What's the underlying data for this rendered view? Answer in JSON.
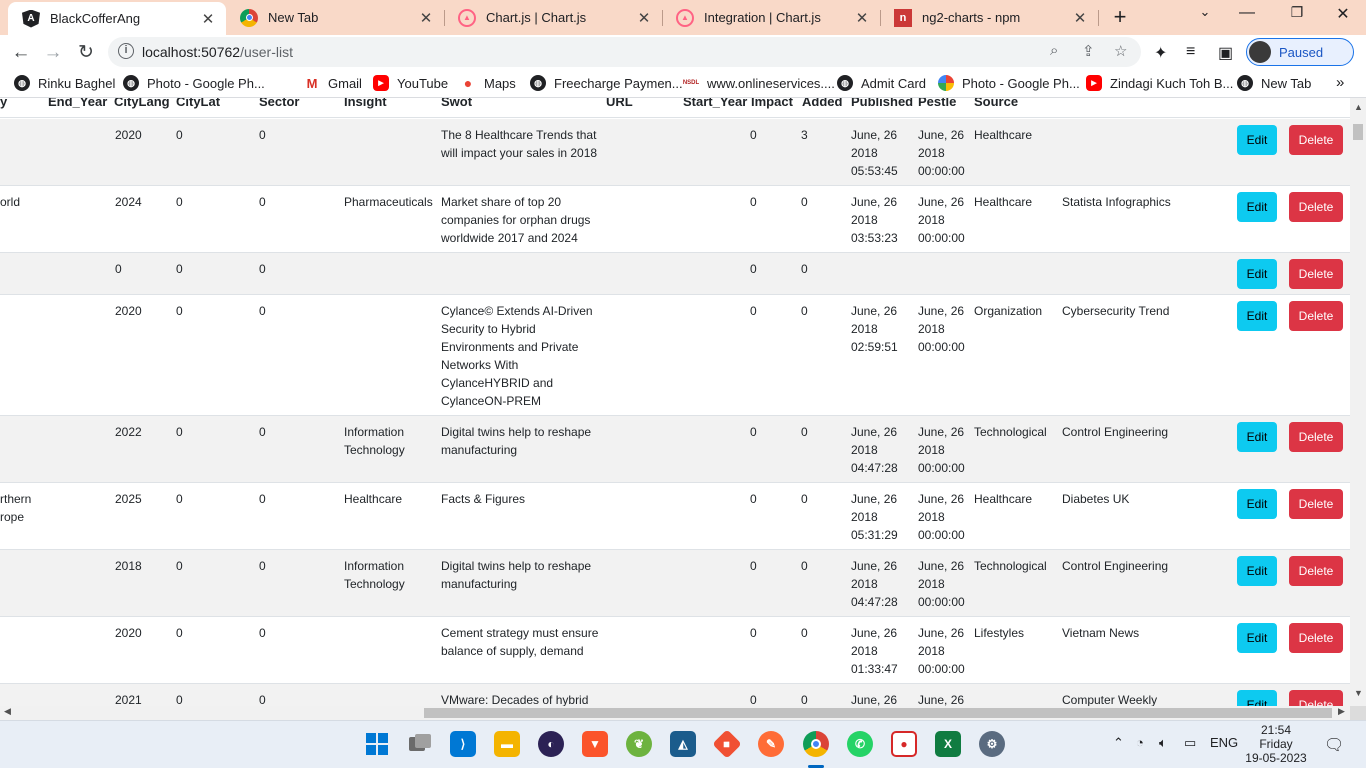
{
  "browser": {
    "tabs": [
      {
        "title": "BlackCofferAng",
        "icon": "angular-icon",
        "active": true
      },
      {
        "title": "New Tab",
        "icon": "chrome-icon",
        "active": false
      },
      {
        "title": "Chart.js | Chart.js",
        "icon": "chartjs-icon",
        "active": false
      },
      {
        "title": "Integration | Chart.js",
        "icon": "chartjs-icon",
        "active": false
      },
      {
        "title": "ng2-charts - npm",
        "icon": "npm-icon",
        "active": false
      }
    ],
    "url_host": "localhost:50762",
    "url_path": "/user-list",
    "profile_label": "Paused",
    "bookmarks": [
      {
        "label": "Rinku Baghel",
        "icon": "globe-icon"
      },
      {
        "label": "Photo - Google Ph...",
        "icon": "globe-icon"
      },
      {
        "label": "Gmail",
        "icon": "gmail-icon"
      },
      {
        "label": "YouTube",
        "icon": "youtube-icon"
      },
      {
        "label": "Maps",
        "icon": "maps-icon"
      },
      {
        "label": "Freecharge Paymen...",
        "icon": "globe-icon"
      },
      {
        "label": "www.onlineservices....",
        "icon": "nsdl-icon"
      },
      {
        "label": "Admit Card",
        "icon": "globe-icon"
      },
      {
        "label": "Photo - Google Ph...",
        "icon": "google-photos-icon"
      },
      {
        "label": "Zindagi Kuch Toh B...",
        "icon": "youtube-icon"
      },
      {
        "label": "New Tab",
        "icon": "globe-icon"
      }
    ],
    "bookmark_more": "»"
  },
  "table": {
    "headers": [
      "y",
      "End_Year",
      "CityLang",
      "CityLat",
      "Sector",
      "Insight",
      "Swot",
      "URL",
      "Start_Year",
      "Impact",
      "Added",
      "Published",
      "Pestle",
      "Source"
    ],
    "edit_label": "Edit",
    "delete_label": "Delete",
    "rows": [
      {
        "country": "",
        "city_lang": "2020",
        "city_lat": "0",
        "sector": "0",
        "insight": "",
        "swot": "The 8 Healthcare Trends that will impact your sales in 2018",
        "impact": "0",
        "added": "3",
        "published": "June, 26 2018 05:53:45",
        "pestle_date": "June, 26 2018 00:00:00",
        "pestle": "Healthcare",
        "source": ""
      },
      {
        "country": "orld",
        "city_lang": "2024",
        "city_lat": "0",
        "sector": "0",
        "insight": "Pharmaceuticals",
        "swot": "Market share of top 20 companies for orphan drugs worldwide 2017 and 2024",
        "impact": "0",
        "added": "0",
        "published": "June, 26 2018 03:53:23",
        "pestle_date": "June, 26 2018 00:00:00",
        "pestle": "Healthcare",
        "source": "Statista Infographics"
      },
      {
        "country": "",
        "city_lang": "0",
        "city_lat": "0",
        "sector": "0",
        "insight": "",
        "swot": "",
        "impact": "0",
        "added": "0",
        "published": "",
        "pestle_date": "",
        "pestle": "",
        "source": ""
      },
      {
        "country": "",
        "city_lang": "2020",
        "city_lat": "0",
        "sector": "0",
        "insight": "",
        "swot": "Cylance© Extends AI-Driven Security to Hybrid Environments and Private Networks With CylanceHYBRID and CylanceON-PREM",
        "impact": "0",
        "added": "0",
        "published": "June, 26 2018 02:59:51",
        "pestle_date": "June, 26 2018 00:00:00",
        "pestle": "Organization",
        "source": "Cybersecurity Trend"
      },
      {
        "country": "",
        "city_lang": "2022",
        "city_lat": "0",
        "sector": "0",
        "insight": "Information Technology",
        "swot": "Digital twins help to reshape manufacturing",
        "impact": "0",
        "added": "0",
        "published": "June, 26 2018 04:47:28",
        "pestle_date": "June, 26 2018 00:00:00",
        "pestle": "Technological",
        "source": "Control Engineering"
      },
      {
        "country": "rthern rope",
        "city_lang": "2025",
        "city_lat": "0",
        "sector": "0",
        "insight": "Healthcare",
        "swot": "Facts & Figures",
        "impact": "0",
        "added": "0",
        "published": "June, 26 2018 05:31:29",
        "pestle_date": "June, 26 2018 00:00:00",
        "pestle": "Healthcare",
        "source": "Diabetes UK"
      },
      {
        "country": "",
        "city_lang": "2018",
        "city_lat": "0",
        "sector": "0",
        "insight": "Information Technology",
        "swot": "Digital twins help to reshape manufacturing",
        "impact": "0",
        "added": "0",
        "published": "June, 26 2018 04:47:28",
        "pestle_date": "June, 26 2018 00:00:00",
        "pestle": "Technological",
        "source": "Control Engineering"
      },
      {
        "country": "",
        "city_lang": "2020",
        "city_lat": "0",
        "sector": "0",
        "insight": "",
        "swot": "Cement strategy must ensure balance of supply, demand",
        "impact": "0",
        "added": "0",
        "published": "June, 26 2018 01:33:47",
        "pestle_date": "June, 26 2018 00:00:00",
        "pestle": "Lifestyles",
        "source": "Vietnam News"
      },
      {
        "country": "",
        "city_lang": "2021",
        "city_lat": "0",
        "sector": "0",
        "insight": "",
        "swot": "VMware: Decades of hybrid",
        "impact": "0",
        "added": "0",
        "published": "June, 26",
        "pestle_date": "June, 26",
        "pestle": "",
        "source": "Computer Weekly"
      }
    ]
  },
  "taskbar": {
    "apps": [
      "windows-start-icon",
      "task-view-icon",
      "vscode-icon",
      "file-explorer-icon",
      "eclipse-icon",
      "brave-icon",
      "spring-tools-icon",
      "mysql-workbench-icon",
      "git-icon",
      "postman-icon",
      "chrome-icon",
      "whatsapp-icon",
      "screen-recorder-icon",
      "excel-icon",
      "settings-icon"
    ],
    "language": "ENG",
    "time": "21:54",
    "day": "Friday",
    "date": "19-05-2023"
  },
  "colors": {
    "tabstrip": "#f9d9c8",
    "edit_button": "#0dcaf0",
    "delete_button": "#dc3545",
    "row_stripe": "#f2f2f2"
  }
}
